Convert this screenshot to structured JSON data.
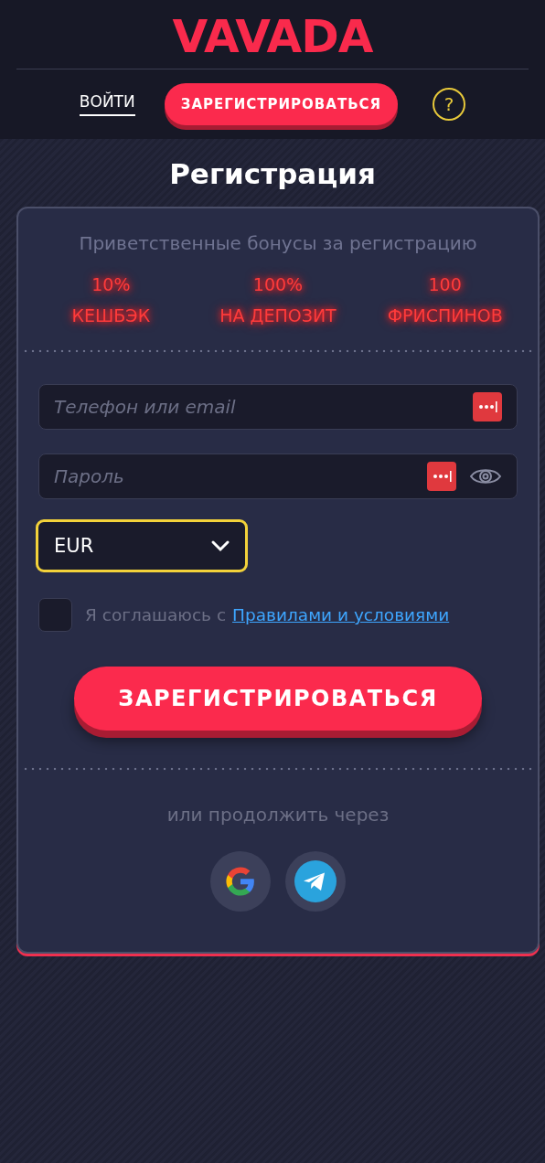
{
  "header": {
    "logo": "VAVADA",
    "login": "ВОЙТИ",
    "register": "ЗАРЕГИСТРИРОВАТЬСЯ",
    "help": "?"
  },
  "title": "Регистрация",
  "bonuses": {
    "heading": "Приветственные бонусы за регистрацию",
    "items": [
      {
        "value": "10%",
        "label": "КЕШБЭК"
      },
      {
        "value": "100%",
        "label": "НА ДЕПОЗИТ"
      },
      {
        "value": "100",
        "label": "ФРИСПИНОВ"
      }
    ]
  },
  "fields": [
    {
      "placeholder": "Телефон или email",
      "kind": "text"
    },
    {
      "placeholder": "Пароль",
      "kind": "password"
    }
  ],
  "currency": {
    "value": "EUR",
    "focused": true
  },
  "agree": {
    "checked": false,
    "text": "Я соглашаюсь с",
    "link": "Правилами и условиями"
  },
  "submit": "ЗАРЕГИСТРИРОВАТЬСЯ",
  "social": {
    "caption": "или продолжить через",
    "providers": [
      {
        "kind": "google"
      },
      {
        "kind": "telegram"
      }
    ]
  }
}
